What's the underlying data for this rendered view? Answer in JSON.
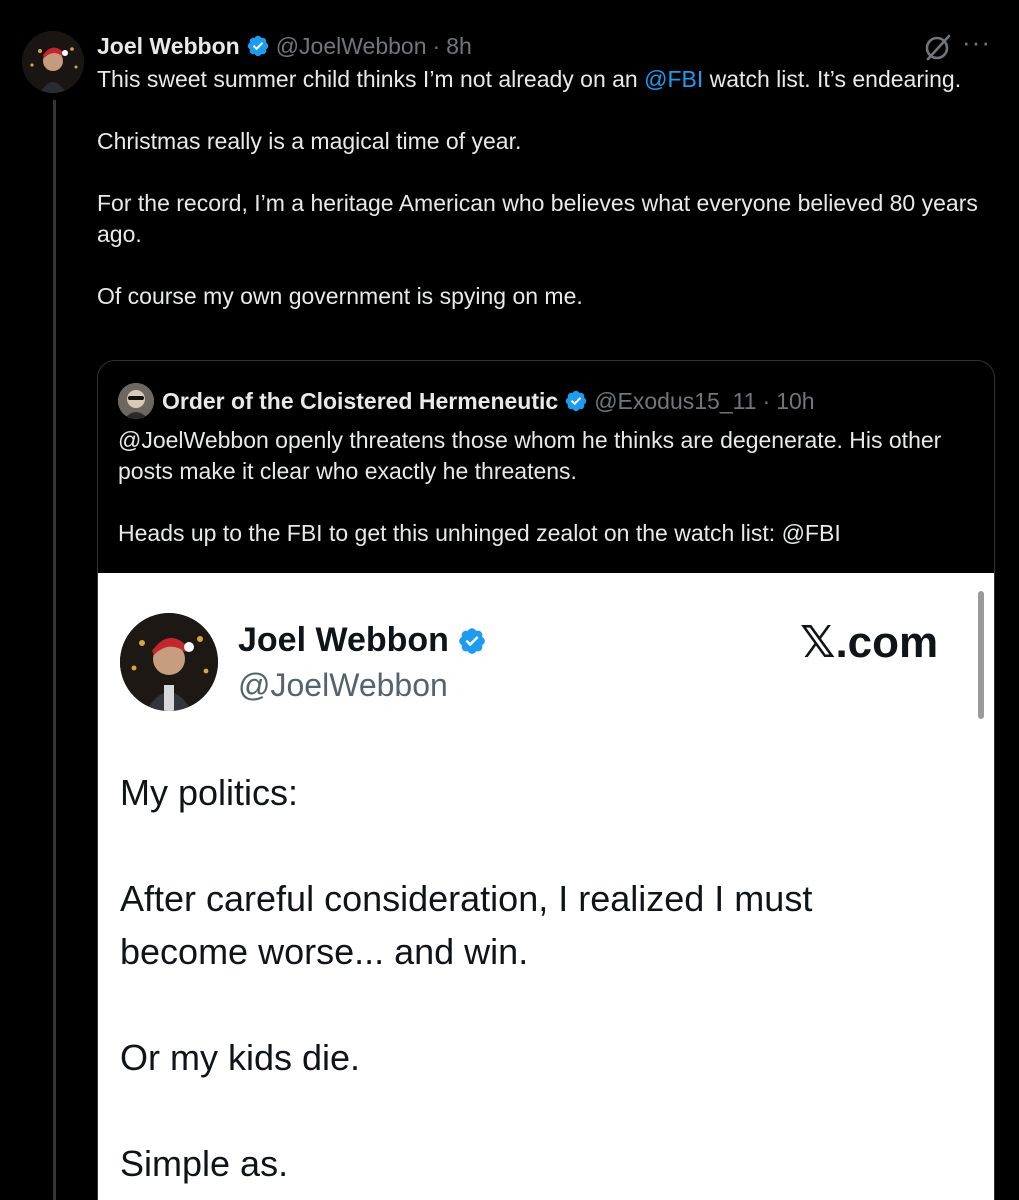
{
  "post": {
    "author_name": "Joel Webbon",
    "author_handle": "@JoelWebbon",
    "separator": "·",
    "time": "8h",
    "more_label": "···",
    "text_segments": {
      "line1_before": "This sweet summer child thinks I’m not already on an ",
      "line1_mention": "@FBI",
      "line1_after": " watch list. It’s endearing.",
      "para2": "Christmas really is a magical time of year.",
      "para3": "For the record, I’m a heritage American who believes what everyone believed 80 years ago.",
      "para4": "Of course my own government is spying on me."
    }
  },
  "quote": {
    "author_name": "Order of the Cloistered Hermeneutic",
    "author_handle": "@Exodus15_11",
    "separator": "·",
    "time": "10h",
    "para1": "@JoelWebbon openly threatens those whom he thinks are degenerate. His other posts make it clear who exactly he threatens.",
    "para2": "Heads up to the FBI to get this unhinged zealot on the watch list: @FBI"
  },
  "quote_image": {
    "name": "Joel Webbon",
    "handle": "@JoelWebbon",
    "brand": "𝕏.com",
    "lines": [
      "My politics:",
      "After careful consideration, I realized I must become worse... and win.",
      "Or my kids die.",
      "Simple as."
    ]
  },
  "colors": {
    "background": "#000000",
    "text": "#e7e9ea",
    "muted": "#71767b",
    "link": "#1d9bf0",
    "verified": "#1d9bf0",
    "border": "#2f3336"
  },
  "icons": {
    "verified": "verified-badge-icon",
    "grok": "grok-icon",
    "more": "more-horizontal-icon"
  }
}
